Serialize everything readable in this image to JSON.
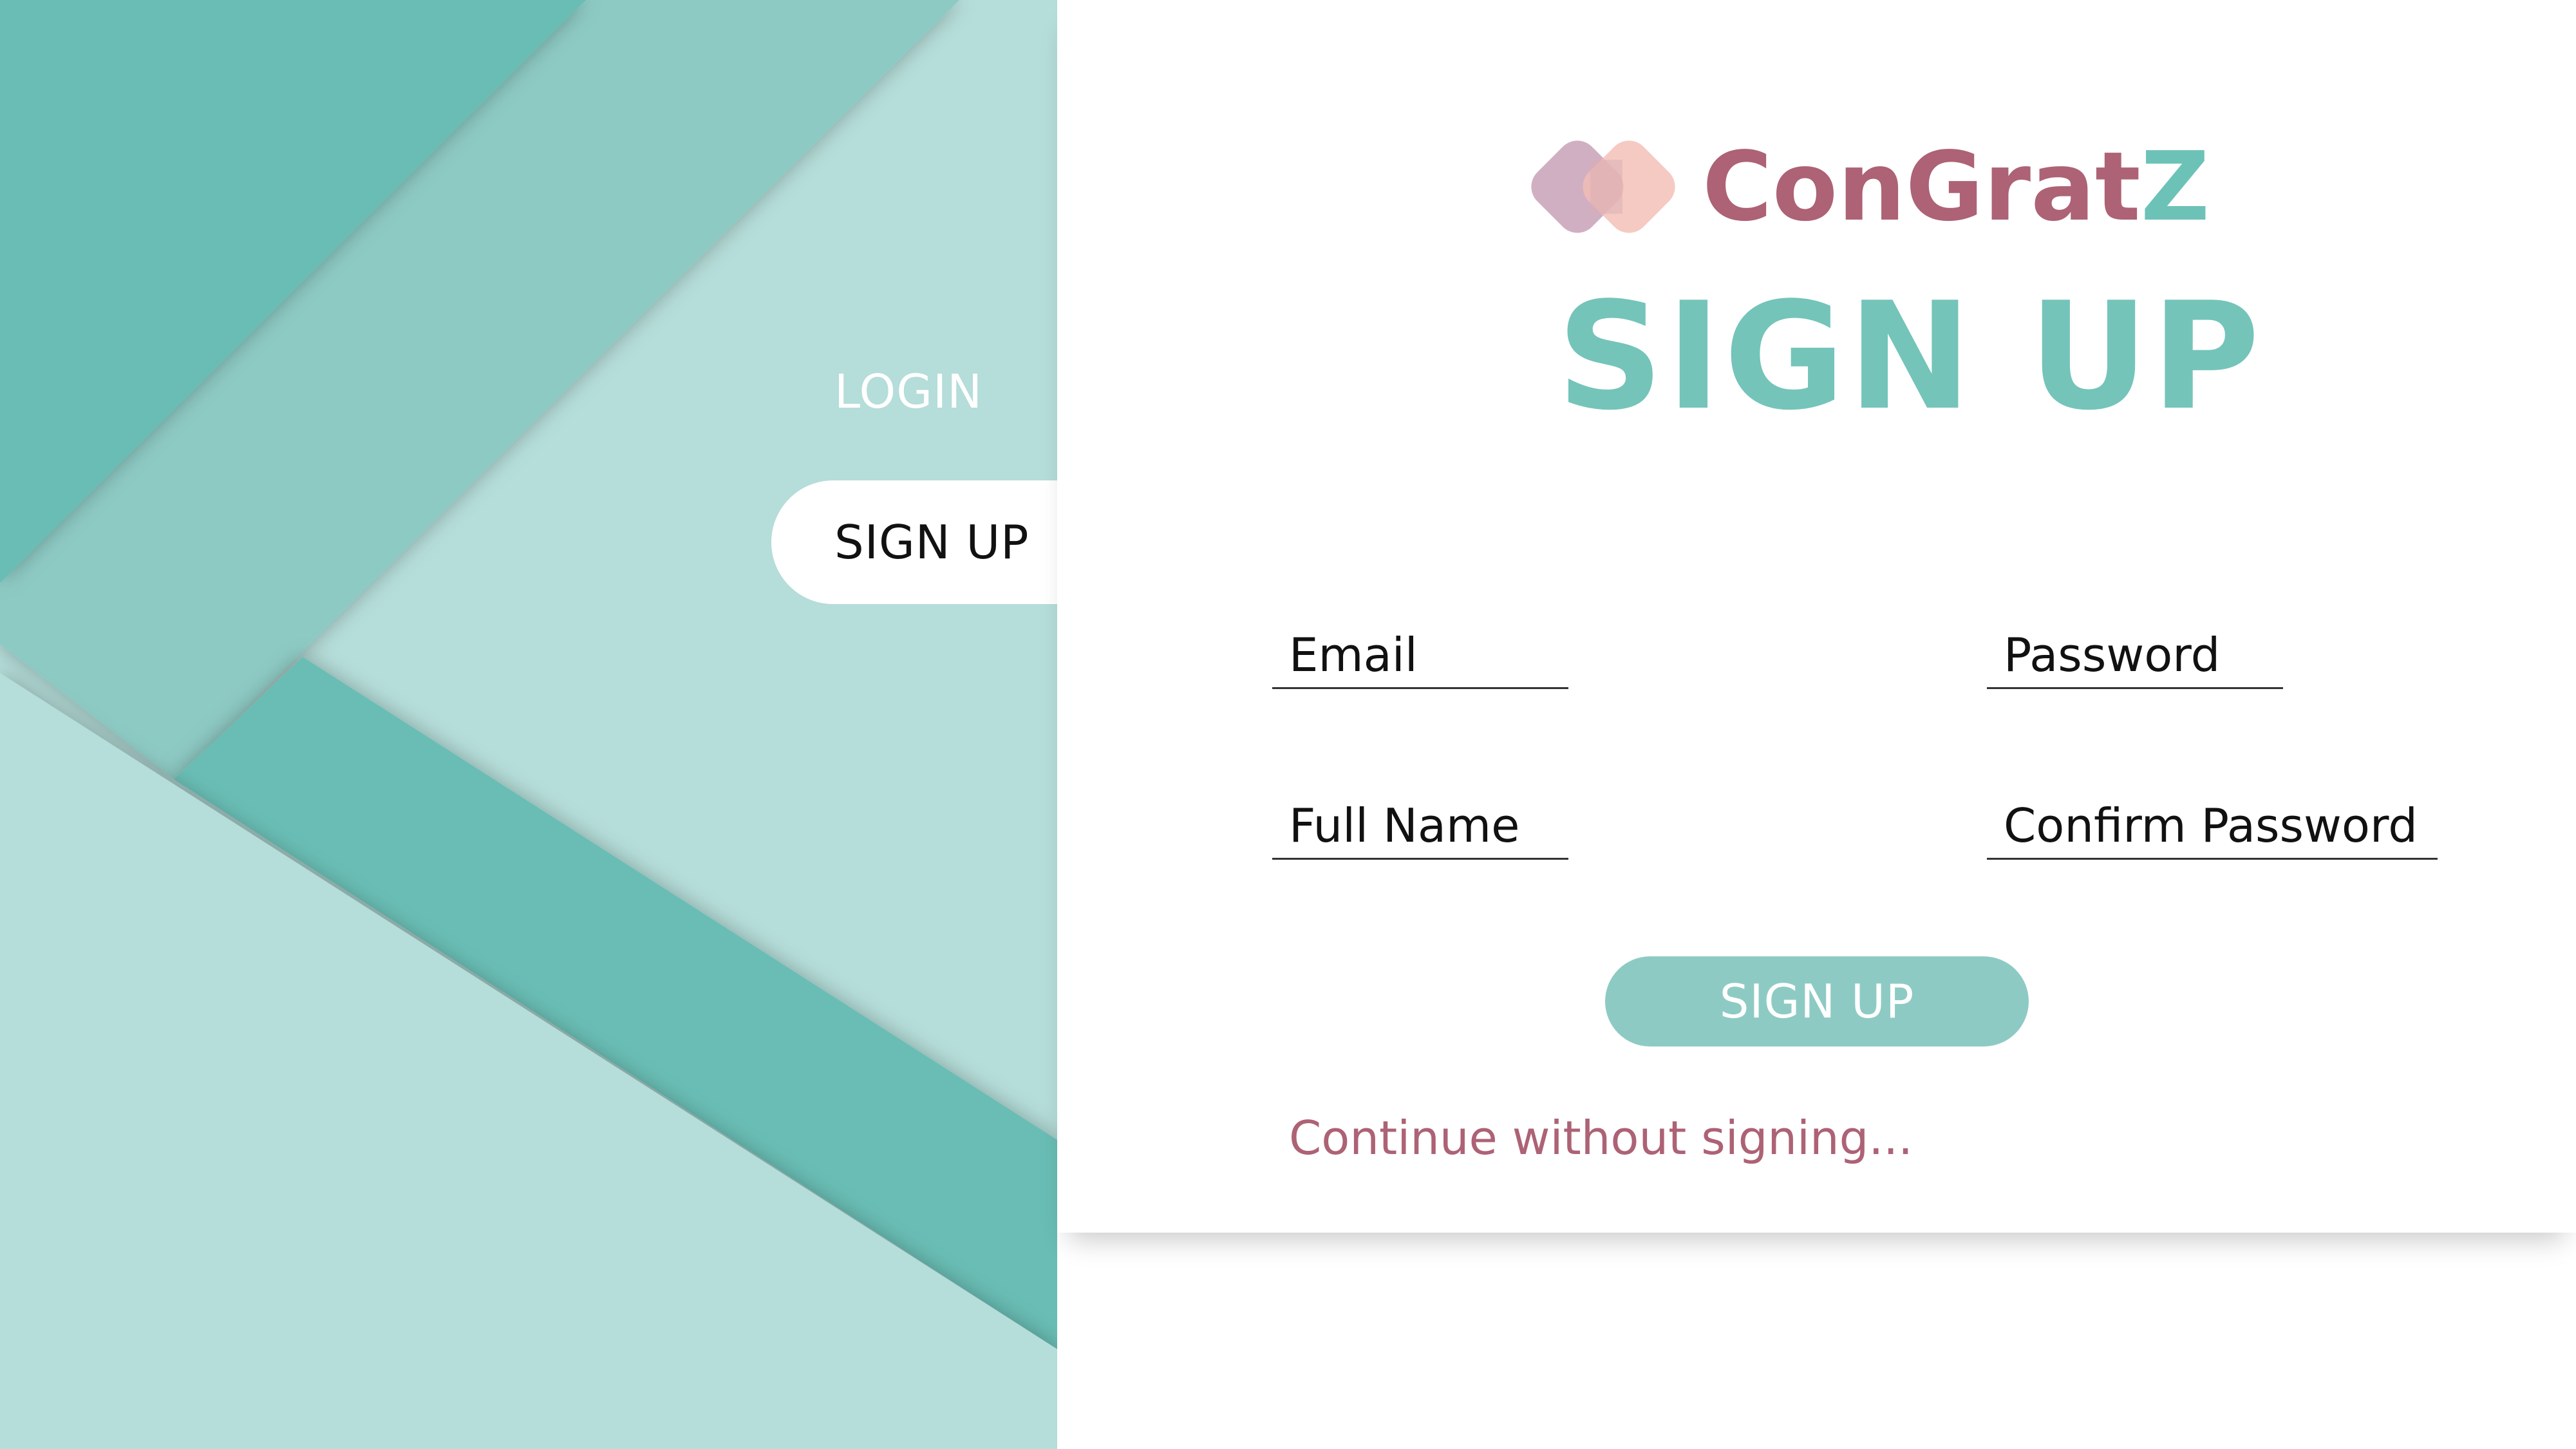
{
  "brand": {
    "name_part1": "ConGrat",
    "name_part2": "Z",
    "color_primary": "#ad6275",
    "color_accent": "#6dc2b7",
    "logo_icon": "two-overlapping-rounded-squares"
  },
  "nav": {
    "login_label": "LOGIN",
    "signup_label": "SIGN UP",
    "active": "SIGN UP"
  },
  "form": {
    "title": "SIGN UP",
    "fields": {
      "email": "Email",
      "password": "Password",
      "full_name": "Full Name",
      "confirm_password": "Confirm Password"
    },
    "submit_label": "SIGN UP",
    "continue_label": "Continue without signing..."
  },
  "colors": {
    "teal_dark": "#69bdb4",
    "teal_mid": "#8ecac4",
    "teal_light": "#b5ddd9",
    "title_teal": "#74c4b9",
    "button_teal": "#8ecac4",
    "link_rose": "#ad6275"
  }
}
